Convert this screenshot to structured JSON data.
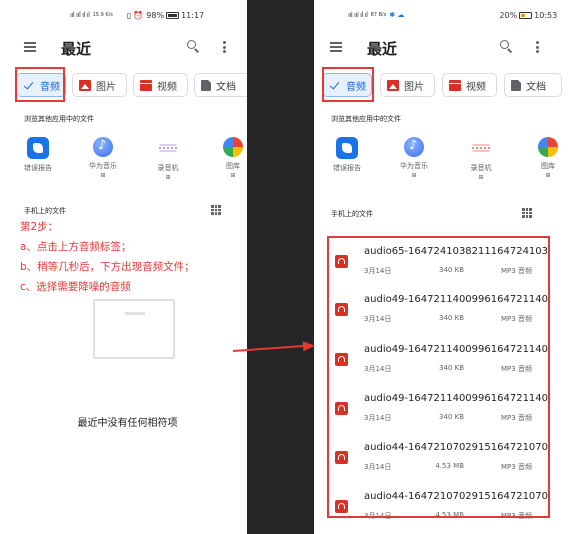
{
  "left_phone": {
    "status": {
      "signal": "ııl ııl ıl ıl",
      "net": "15.9 K/s",
      "vibrate": "▯",
      "alarm": "⏰",
      "battery": "98%",
      "time": "11:17"
    },
    "title": "最近",
    "chips": [
      "音频",
      "图片",
      "视频",
      "文档"
    ],
    "browse_label": "浏览其他应用中的文件",
    "apps": [
      {
        "name": "错误报告",
        "badge": ""
      },
      {
        "name": "华为音乐",
        "badge": "⊞"
      },
      {
        "name": "录音机",
        "badge": "⊞"
      },
      {
        "name": "图库",
        "badge": "⊞"
      }
    ],
    "phone_files_label": "手机上的文件",
    "steps": [
      "第2步：",
      "a、点击上方音频标签；",
      "b、稍等几秒后，下方出现音频文件；",
      "c、选择需要降噪的音频"
    ],
    "empty_text": "最近中没有任何相符项"
  },
  "right_phone": {
    "status": {
      "signal": "ııl ııl ıl ıl",
      "net": "87 B/s",
      "extra": "✱ ☁",
      "battery": "20%",
      "time": "10:53"
    },
    "title": "最近",
    "chips": [
      "音频",
      "图片",
      "视频",
      "文档"
    ],
    "browse_label": "浏览其他应用中的文件",
    "apps": [
      {
        "name": "错误报告",
        "badge": ""
      },
      {
        "name": "华为音乐",
        "badge": "⊞"
      },
      {
        "name": "录音机",
        "badge": "⊞"
      },
      {
        "name": "图库",
        "badge": "⊞"
      }
    ],
    "phone_files_label": "手机上的文件",
    "files": [
      {
        "name": "audio65-16472410382111647241038",
        "date": "3月14日",
        "size": "340 KB",
        "type": "MP3 音频"
      },
      {
        "name": "audio49-16472114009961647211400",
        "date": "3月14日",
        "size": "340 KB",
        "type": "MP3 音频"
      },
      {
        "name": "audio49-16472114009961647211400",
        "date": "3月14日",
        "size": "340 KB",
        "type": "MP3 音频"
      },
      {
        "name": "audio49-16472114009961647211400",
        "date": "3月14日",
        "size": "340 KB",
        "type": "MP3 音频"
      },
      {
        "name": "audio44-16472107029151647210702",
        "date": "3月14日",
        "size": "4.53 MB",
        "type": "MP3 音频"
      },
      {
        "name": "audio44-16472107029151647210702",
        "date": "3月14日",
        "size": "4.53 MB",
        "type": "MP3 音频"
      }
    ]
  },
  "colors": {
    "annotation_red": "#e53935",
    "selected_chip_bg": "#e8f0fe",
    "accent_blue": "#1967d2",
    "audio_red": "#d93025"
  }
}
